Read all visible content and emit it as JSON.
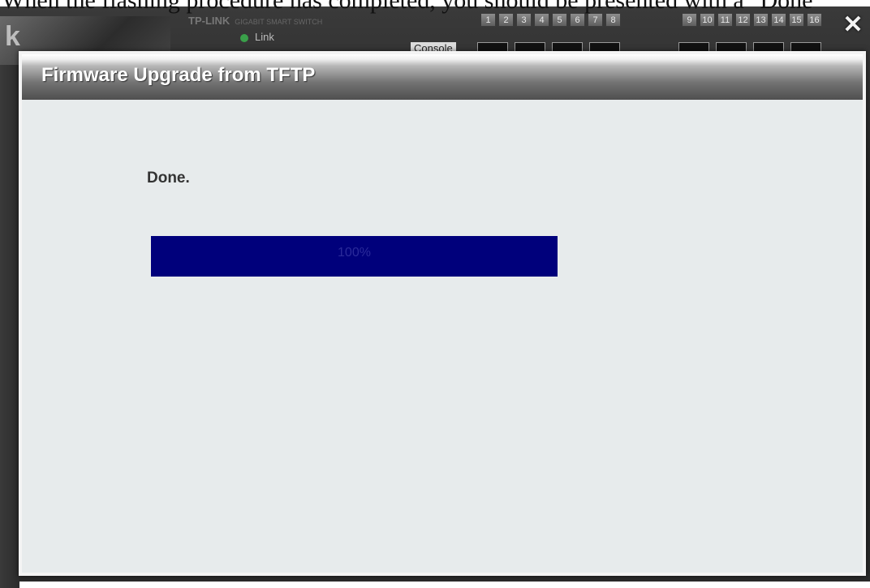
{
  "caption": "When the flashing procedure has completed, you should be presented with a \"Done\"",
  "background": {
    "brand": "TP-LINK",
    "brand_sub": "GIGABIT SMART SWITCH",
    "link_label": "Link",
    "console_label": "Console",
    "ports": [
      "1",
      "2",
      "3",
      "4",
      "5",
      "6",
      "7",
      "8",
      "9",
      "10",
      "11",
      "12",
      "13",
      "14",
      "15",
      "16"
    ]
  },
  "dialog": {
    "title": "Firmware Upgrade from TFTP",
    "close_glyph": "✕",
    "status": "Done.",
    "progress": {
      "fraction": 1.0,
      "label": "100%",
      "fill_color": "#00007b"
    }
  },
  "icons": {
    "close": "close-icon"
  }
}
